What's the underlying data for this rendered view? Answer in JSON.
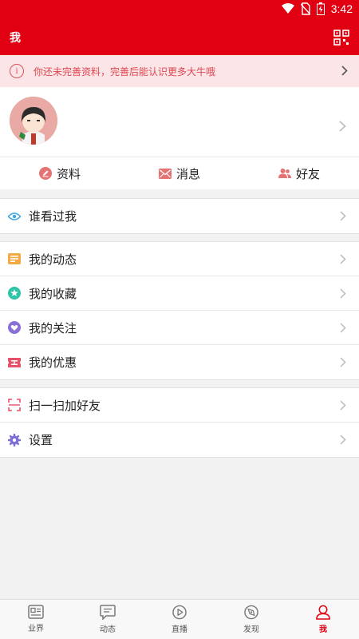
{
  "status_bar": {
    "time": "3:42"
  },
  "header": {
    "title": "我"
  },
  "notice": {
    "text": "你还未完善资料，完善后能认识更多大牛哦"
  },
  "actions": [
    {
      "label": "资料"
    },
    {
      "label": "消息"
    },
    {
      "label": "好友"
    }
  ],
  "menu": {
    "group1": [
      {
        "label": "谁看过我"
      }
    ],
    "group2": [
      {
        "label": "我的动态"
      },
      {
        "label": "我的收藏"
      },
      {
        "label": "我的关注"
      },
      {
        "label": "我的优惠"
      }
    ],
    "group3": [
      {
        "label": "扫一扫加好友"
      },
      {
        "label": "设置"
      }
    ]
  },
  "tabbar": [
    {
      "label": "业界"
    },
    {
      "label": "动态"
    },
    {
      "label": "直播"
    },
    {
      "label": "发现"
    },
    {
      "label": "我"
    }
  ],
  "colors": {
    "brand": "#e00012",
    "notice_bg": "#fbe5e6",
    "notice_text": "#e04651"
  }
}
